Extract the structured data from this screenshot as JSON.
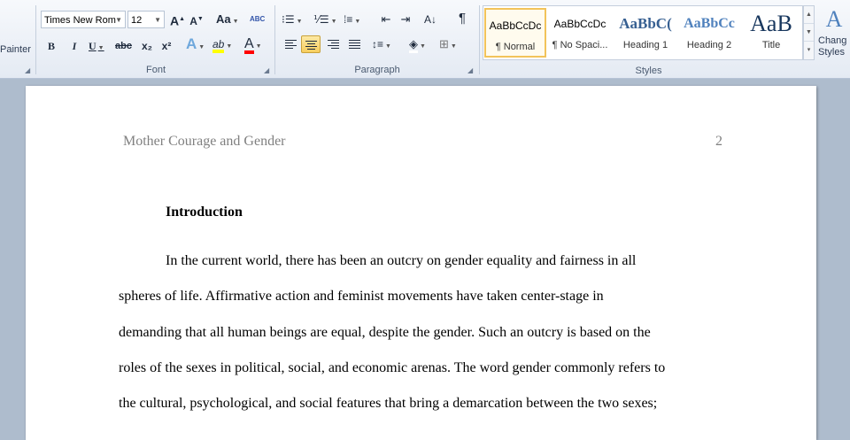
{
  "clipboard": {
    "painter_label": "Painter"
  },
  "font_group": {
    "label": "Font",
    "font_name": "Times New Rom",
    "font_size": "12",
    "grow_font": "A",
    "shrink_font": "A",
    "change_case": "Aa",
    "clear_format": "ABC",
    "bold": "B",
    "italic": "I",
    "underline": "U",
    "strikethrough": "abc",
    "subscript": "x₂",
    "superscript": "x²",
    "text_effects": "A",
    "highlight": "ab",
    "font_color": "A",
    "highlight_color": "#ffff00",
    "font_color_value": "#ff0000"
  },
  "paragraph_group": {
    "label": "Paragraph",
    "show_marks": "¶"
  },
  "styles_group": {
    "label": "Styles",
    "items": [
      {
        "sample": "AaBbCcDc",
        "name": "¶ Normal",
        "selected": true
      },
      {
        "sample": "AaBbCcDc",
        "name": "¶ No Spaci...",
        "selected": false
      },
      {
        "sample": "AaBbC(",
        "name": "Heading 1",
        "selected": false
      },
      {
        "sample": "AaBbCc",
        "name": "Heading 2",
        "selected": false
      },
      {
        "sample": "AaB",
        "name": "Title",
        "selected": false
      }
    ],
    "change_styles_line1": "Chang",
    "change_styles_line2": "Styles"
  },
  "document": {
    "header_title": "Mother Courage and Gender",
    "page_number": "2",
    "heading": "Introduction",
    "lines": [
      "In the current world, there has been an outcry on gender equality and fairness in all",
      "spheres of life. Affirmative action and feminist movements have taken center-stage in",
      "demanding that all human beings are equal, despite the gender. Such an outcry is based on the",
      "roles of the sexes in political, social, and economic arenas. The word gender commonly refers to",
      "the cultural, psychological, and social features that bring a demarcation between the two sexes;"
    ]
  }
}
